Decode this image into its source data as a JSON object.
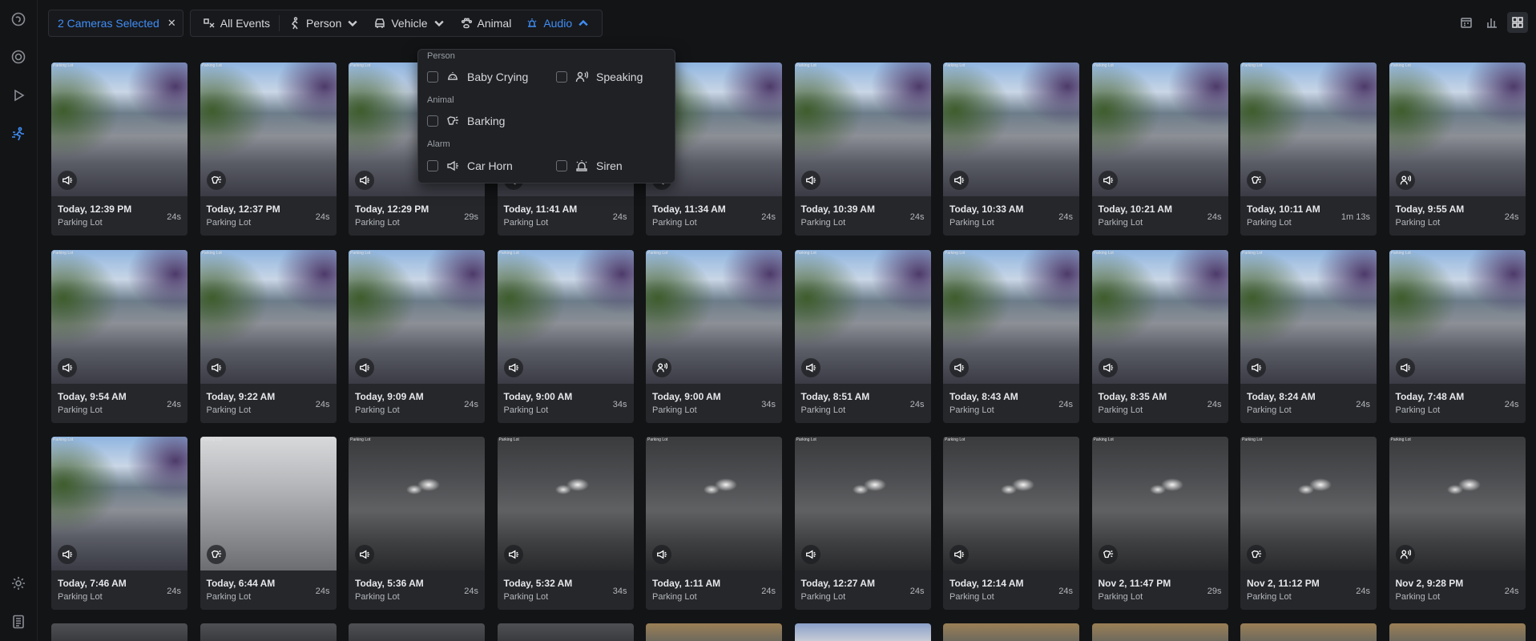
{
  "topbar": {
    "camera_chip": "2 Cameras Selected",
    "filters": [
      {
        "label": "All Events",
        "icon": "all-events-icon"
      },
      {
        "label": "Person",
        "icon": "person-icon"
      },
      {
        "label": "Vehicle",
        "icon": "vehicle-icon"
      },
      {
        "label": "Animal",
        "icon": "animal-icon"
      },
      {
        "label": "Audio",
        "icon": "audio-icon",
        "active": true
      }
    ]
  },
  "dropdown": {
    "sections": [
      {
        "title": "Person",
        "items": [
          "Baby Crying",
          "Speaking"
        ]
      },
      {
        "title": "Animal",
        "items": [
          "Barking"
        ]
      },
      {
        "title": "Alarm",
        "items": [
          "Car Horn",
          "Siren"
        ]
      }
    ]
  },
  "colors": {
    "accent": "#3f8ef7",
    "background": "#131416",
    "card": "#25272b"
  },
  "events": [
    {
      "time": "Today, 12:39 PM",
      "location": "Parking Lot",
      "duration": "24s",
      "icon": "car-horn",
      "scene": "day"
    },
    {
      "time": "Today, 12:37 PM",
      "location": "Parking Lot",
      "duration": "24s",
      "icon": "barking",
      "scene": "day"
    },
    {
      "time": "Today, 12:29 PM",
      "location": "Parking Lot",
      "duration": "29s",
      "icon": "car-horn",
      "scene": "day"
    },
    {
      "time": "Today, 11:41 AM",
      "location": "Parking Lot",
      "duration": "24s",
      "icon": "car-horn",
      "scene": "day"
    },
    {
      "time": "Today, 11:34 AM",
      "location": "Parking Lot",
      "duration": "24s",
      "icon": "car-horn",
      "scene": "day"
    },
    {
      "time": "Today, 10:39 AM",
      "location": "Parking Lot",
      "duration": "24s",
      "icon": "car-horn",
      "scene": "day"
    },
    {
      "time": "Today, 10:33 AM",
      "location": "Parking Lot",
      "duration": "24s",
      "icon": "car-horn",
      "scene": "day"
    },
    {
      "time": "Today, 10:21 AM",
      "location": "Parking Lot",
      "duration": "24s",
      "icon": "car-horn",
      "scene": "day"
    },
    {
      "time": "Today, 10:11 AM",
      "location": "Parking Lot",
      "duration": "1m 13s",
      "icon": "barking",
      "scene": "day"
    },
    {
      "time": "Today, 9:55 AM",
      "location": "Parking Lot",
      "duration": "24s",
      "icon": "speaking",
      "scene": "day"
    },
    {
      "time": "Today, 9:54 AM",
      "location": "Parking Lot",
      "duration": "24s",
      "icon": "car-horn",
      "scene": "day"
    },
    {
      "time": "Today, 9:22 AM",
      "location": "Parking Lot",
      "duration": "24s",
      "icon": "car-horn",
      "scene": "day"
    },
    {
      "time": "Today, 9:09 AM",
      "location": "Parking Lot",
      "duration": "24s",
      "icon": "car-horn",
      "scene": "day"
    },
    {
      "time": "Today, 9:00 AM",
      "location": "Parking Lot",
      "duration": "34s",
      "icon": "car-horn",
      "scene": "day"
    },
    {
      "time": "Today, 9:00 AM",
      "location": "Parking Lot",
      "duration": "34s",
      "icon": "speaking",
      "scene": "day"
    },
    {
      "time": "Today, 8:51 AM",
      "location": "Parking Lot",
      "duration": "24s",
      "icon": "car-horn",
      "scene": "day"
    },
    {
      "time": "Today, 8:43 AM",
      "location": "Parking Lot",
      "duration": "24s",
      "icon": "car-horn",
      "scene": "day"
    },
    {
      "time": "Today, 8:35 AM",
      "location": "Parking Lot",
      "duration": "24s",
      "icon": "car-horn",
      "scene": "day"
    },
    {
      "time": "Today, 8:24 AM",
      "location": "Parking Lot",
      "duration": "24s",
      "icon": "car-horn",
      "scene": "day"
    },
    {
      "time": "Today, 7:48 AM",
      "location": "Parking Lot",
      "duration": "24s",
      "icon": "car-horn",
      "scene": "day"
    },
    {
      "time": "Today, 7:46 AM",
      "location": "Parking Lot",
      "duration": "24s",
      "icon": "car-horn",
      "scene": "day"
    },
    {
      "time": "Today, 6:44 AM",
      "location": "Parking Lot",
      "duration": "24s",
      "icon": "barking",
      "scene": "gray"
    },
    {
      "time": "Today, 5:36 AM",
      "location": "Parking Lot",
      "duration": "24s",
      "icon": "car-horn",
      "scene": "night"
    },
    {
      "time": "Today, 5:32 AM",
      "location": "Parking Lot",
      "duration": "34s",
      "icon": "car-horn",
      "scene": "night"
    },
    {
      "time": "Today, 1:11 AM",
      "location": "Parking Lot",
      "duration": "24s",
      "icon": "car-horn",
      "scene": "night"
    },
    {
      "time": "Today, 12:27 AM",
      "location": "Parking Lot",
      "duration": "24s",
      "icon": "car-horn",
      "scene": "night"
    },
    {
      "time": "Today, 12:14 AM",
      "location": "Parking Lot",
      "duration": "24s",
      "icon": "car-horn",
      "scene": "night"
    },
    {
      "time": "Nov 2, 11:47 PM",
      "location": "Parking Lot",
      "duration": "29s",
      "icon": "barking",
      "scene": "night"
    },
    {
      "time": "Nov 2, 11:12 PM",
      "location": "Parking Lot",
      "duration": "24s",
      "icon": "barking",
      "scene": "night"
    },
    {
      "time": "Nov 2, 9:28 PM",
      "location": "Parking Lot",
      "duration": "24s",
      "icon": "speaking",
      "scene": "night"
    }
  ],
  "peek_row": [
    "night",
    "night",
    "night",
    "night",
    "day",
    "blue",
    "day",
    "day",
    "day",
    "day"
  ],
  "thumb_label": "Parking Lot"
}
